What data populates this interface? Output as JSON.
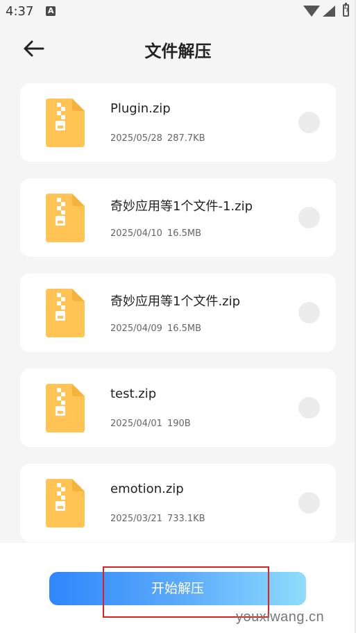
{
  "status_bar": {
    "time": "4:37"
  },
  "header": {
    "title": "文件解压"
  },
  "files": [
    {
      "name": "Plugin.zip",
      "date": "2025/05/28",
      "size": "287.7KB"
    },
    {
      "name": "奇妙应用等1个文件-1.zip",
      "date": "2025/04/10",
      "size": "16.5MB"
    },
    {
      "name": "奇妙应用等1个文件.zip",
      "date": "2025/04/09",
      "size": "16.5MB"
    },
    {
      "name": "test.zip",
      "date": "2025/04/01",
      "size": "190B"
    },
    {
      "name": "emotion.zip",
      "date": "2025/03/21",
      "size": "733.1KB"
    }
  ],
  "bottom": {
    "start_label": "开始解压",
    "watermark": "youxiwang.cn"
  },
  "colors": {
    "zip_icon": "#ffc453",
    "zip_fold": "#f7b23b",
    "button_start": "#2f87fb",
    "button_end": "#8fdcfc",
    "highlight": "#e02020"
  }
}
